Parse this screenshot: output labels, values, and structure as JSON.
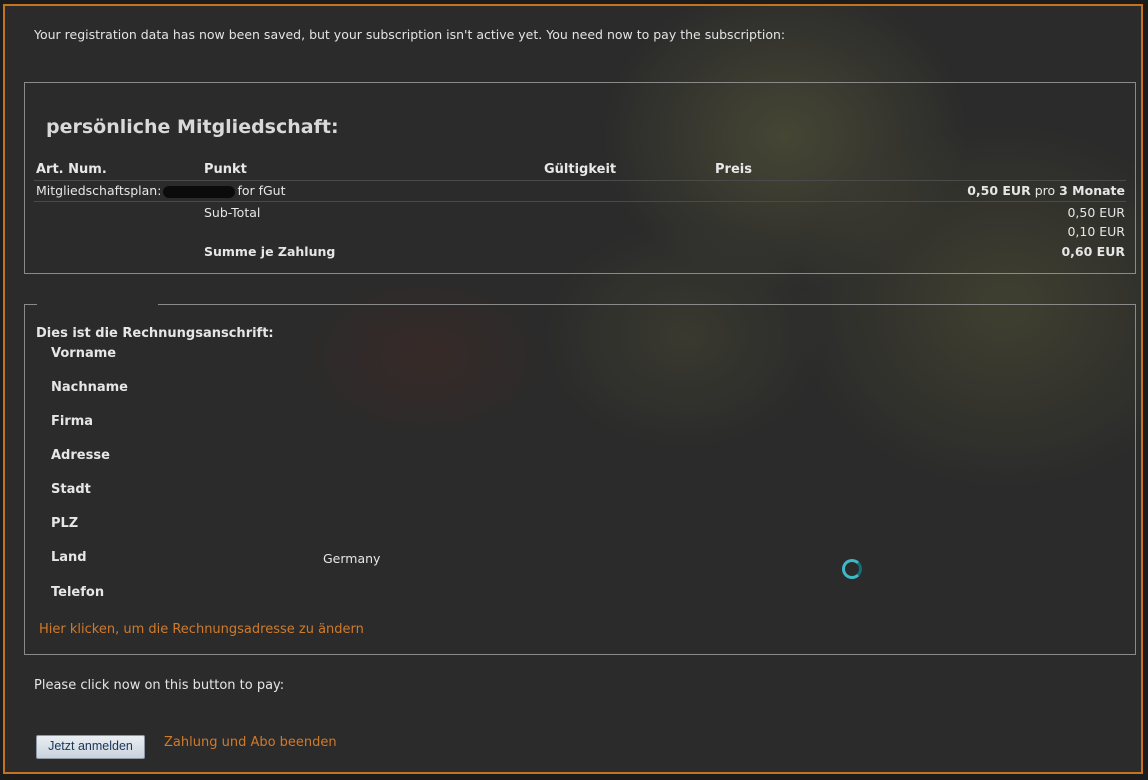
{
  "intro_text": "Your registration data has now been saved, but your subscription isn't active yet. You need now to pay the subscription:",
  "membership": {
    "title": "persönliche Mitgliedschaft:",
    "headers": {
      "art_num": "Art. Num.",
      "punkt": "Punkt",
      "gueltigkeit": "Gültigkeit",
      "preis": "Preis"
    },
    "plan_row": {
      "label_prefix": "Mitgliedschaftsplan:",
      "label_suffix": "for fGut",
      "price": "0,50 EUR",
      "per": "pro",
      "period": "3 Monate"
    },
    "subtotal_label": "Sub-Total",
    "subtotal_value": "0,50 EUR",
    "tax_value": "0,10 EUR",
    "total_label": "Summe je Zahlung",
    "total_value": "0,60 EUR"
  },
  "billing": {
    "title": "Dies ist die Rechnungsanschrift:",
    "fields": [
      {
        "label": "Vorname",
        "value": ""
      },
      {
        "label": "Nachname",
        "value": ""
      },
      {
        "label": "Firma",
        "value": ""
      },
      {
        "label": "Adresse",
        "value": ""
      },
      {
        "label": "Stadt",
        "value": ""
      },
      {
        "label": "PLZ",
        "value": ""
      },
      {
        "label": "Land",
        "value": "Germany"
      },
      {
        "label": "Telefon",
        "value": ""
      }
    ],
    "change_link": "Hier klicken, um die Rechnungsadresse zu ändern"
  },
  "pay_prompt": "Please click now on this button to pay:",
  "pay_button": "Jetzt anmelden",
  "cancel_link": "Zahlung und Abo beenden",
  "colors": {
    "accent": "#c5731f",
    "link": "#d07a2a",
    "spinner": "#3fb9c8"
  }
}
